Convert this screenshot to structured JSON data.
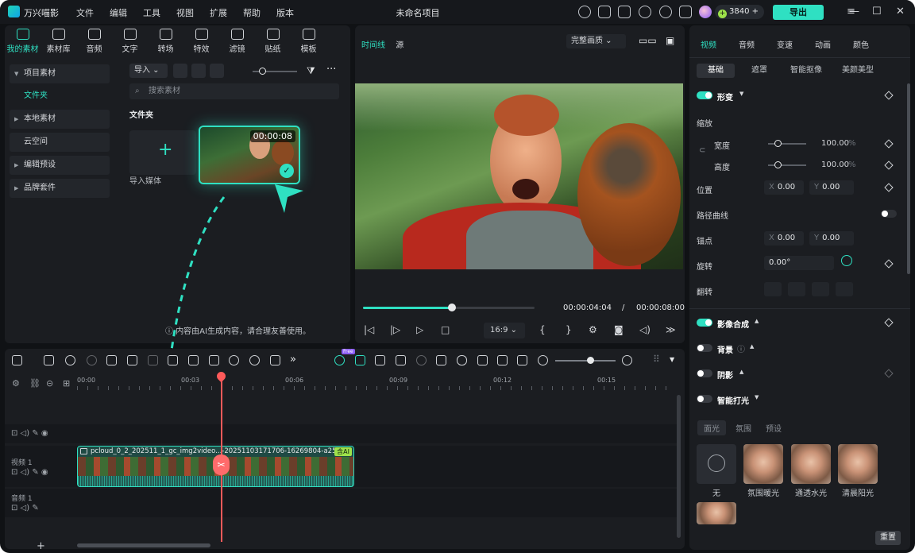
{
  "app": {
    "name": "万兴喵影",
    "menu": [
      "文件",
      "编辑",
      "工具",
      "视图",
      "扩展",
      "帮助",
      "版本"
    ],
    "project_title": "未命名项目",
    "credits": "3840",
    "export_label": "导出",
    "accent_color": "#2fe0c2"
  },
  "media_panel": {
    "tabs": [
      {
        "label": "我的素材",
        "icon": "my-media-icon",
        "active": true
      },
      {
        "label": "素材库",
        "icon": "library-icon"
      },
      {
        "label": "音频",
        "icon": "music-icon"
      },
      {
        "label": "文字",
        "icon": "text-icon"
      },
      {
        "label": "转场",
        "icon": "transition-icon"
      },
      {
        "label": "特效",
        "icon": "effects-icon"
      },
      {
        "label": "滤镜",
        "icon": "filter-icon"
      },
      {
        "label": "贴纸",
        "icon": "sticker-icon"
      },
      {
        "label": "模板",
        "icon": "template-icon"
      }
    ],
    "sidebar": [
      {
        "label": "项目素材"
      },
      {
        "label": "文件夹"
      },
      {
        "label": "本地素材"
      },
      {
        "label": "云空间"
      },
      {
        "label": "编辑预设"
      },
      {
        "label": "品牌套件"
      }
    ],
    "import_label": "导入",
    "search_placeholder": "搜索素材",
    "folder_title": "文件夹",
    "import_media_label": "导入媒体",
    "clip_duration": "00:00:08",
    "ai_notice": "内容由AI生成内容，请合理友善使用。"
  },
  "preview": {
    "tabs": [
      "时间线",
      "源"
    ],
    "quality": "完整画质",
    "current_time": "00:00:04:04",
    "separator": "/",
    "total_time": "00:00:08:00",
    "progress_fraction": 0.52,
    "ratio": "16:9"
  },
  "inspector": {
    "tabs": [
      "视频",
      "音频",
      "变速",
      "动画",
      "颜色"
    ],
    "subtabs": [
      "基础",
      "遮罩",
      "智能抠像",
      "美颜美型"
    ],
    "transform_label": "形变",
    "scale_label": "缩放",
    "width_label": "宽度",
    "width_value": "100.00",
    "height_label": "高度",
    "height_value": "100.00",
    "percent_unit": "%",
    "position_label": "位置",
    "pos_x": "0.00",
    "pos_y": "0.00",
    "x_axis": "X",
    "y_axis": "Y",
    "path_curve_label": "路径曲线",
    "anchor_label": "锚点",
    "anchor_x": "0.00",
    "anchor_y": "0.00",
    "rotate_label": "旋转",
    "rotate_value": "0.00°",
    "flip_label": "翻转",
    "composite_label": "影像合成",
    "background_label": "背景",
    "shadow_label": "阴影",
    "smart_light_label": "智能打光",
    "light_tabs": [
      "面光",
      "氛围",
      "预设"
    ],
    "presets": [
      {
        "label": "无"
      },
      {
        "label": "氛围暖光"
      },
      {
        "label": "通透水光"
      },
      {
        "label": "清晨阳光"
      }
    ],
    "reset_label": "重置"
  },
  "timeline": {
    "ruler": [
      "00:00",
      "00:03",
      "00:06",
      "00:09",
      "00:12",
      "00:15"
    ],
    "video_track_label": "视频 1",
    "audio_track_label": "音频 1",
    "clip_name": "pcloud_0_2_202511_1_gc_img2video...-20251103171706-16269804-a2524-0",
    "ai_tag": "含AI",
    "new_badge": "Free"
  }
}
